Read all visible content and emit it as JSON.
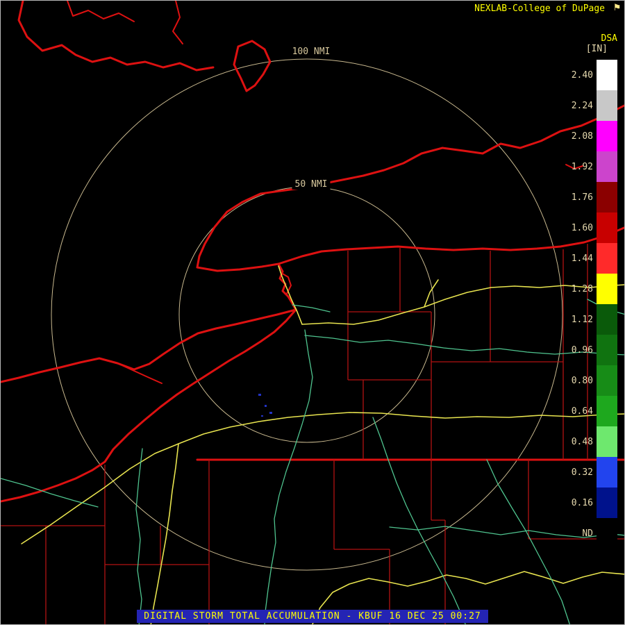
{
  "header": {
    "brand": "NEXLAB-College of DuPage"
  },
  "product": {
    "code": "DSA",
    "units": "[IN]"
  },
  "range_rings": {
    "outer_label": "100 NMI",
    "inner_label": "50 NMI"
  },
  "legend": {
    "entries": [
      {
        "label": "2.40",
        "color": "#ffffff"
      },
      {
        "label": "2.24",
        "color": "#c8c8c8"
      },
      {
        "label": "2.08",
        "color": "#ff00ff"
      },
      {
        "label": "1.92",
        "color": "#cc44cc"
      },
      {
        "label": "1.76",
        "color": "#8b0000"
      },
      {
        "label": "1.60",
        "color": "#c80000"
      },
      {
        "label": "1.44",
        "color": "#ff2a2a"
      },
      {
        "label": "1.28",
        "color": "#ffff00"
      },
      {
        "label": "1.12",
        "color": "#0a5a0a"
      },
      {
        "label": "0.96",
        "color": "#107310"
      },
      {
        "label": "0.80",
        "color": "#178c17"
      },
      {
        "label": "0.64",
        "color": "#1ea81e"
      },
      {
        "label": "0.48",
        "color": "#6ee86e"
      },
      {
        "label": "0.32",
        "color": "#2244ee"
      },
      {
        "label": "0.16",
        "color": "#00128c"
      },
      {
        "label": "ND",
        "color": "#000000"
      }
    ]
  },
  "status_bar": {
    "text": "DIGITAL STORM TOTAL ACCUMULATION - KBUF 16 DEC 25 00:27"
  },
  "colors": {
    "background": "#000000",
    "brand_text": "#ffff00",
    "ring": "#c9b98f",
    "ring_label": "#d6c79c",
    "legend_text": "#e6d9ae",
    "state_border": "#dd1111",
    "county_line": "#b31212",
    "interstate": "#e8e44f",
    "highway": "#4fc48f",
    "status_bar_bg": "#2424b4",
    "status_text": "#ffff00",
    "echo": "#2333c4"
  }
}
